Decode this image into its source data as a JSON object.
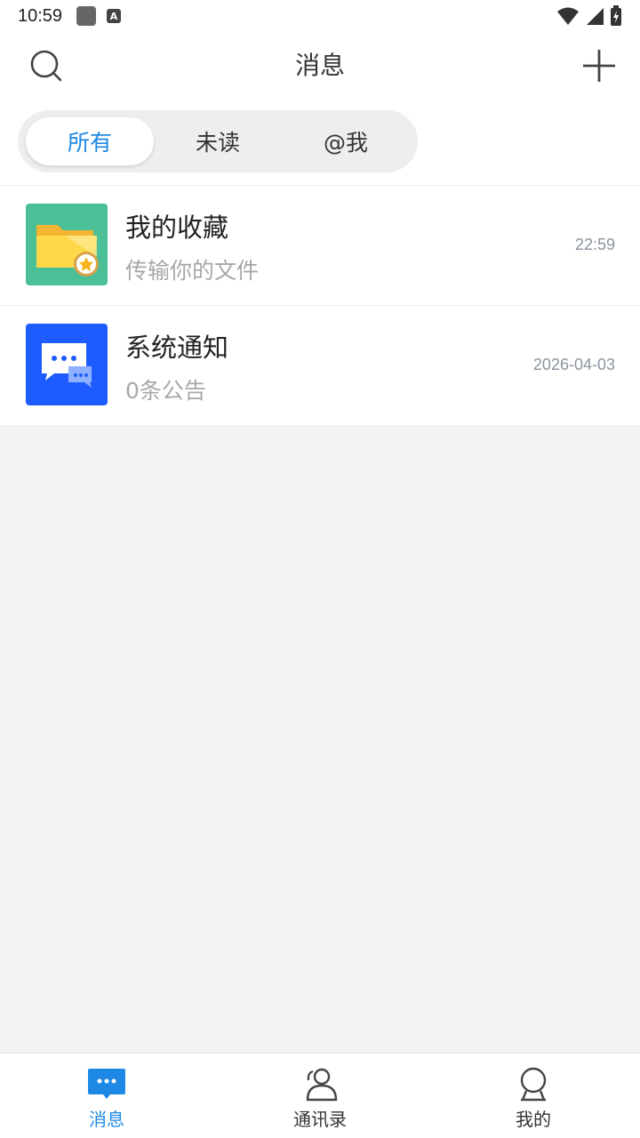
{
  "status_bar": {
    "time": "10:59",
    "badge_letter": "A"
  },
  "header": {
    "title": "消息"
  },
  "tabs": [
    {
      "label": "所有",
      "active": true
    },
    {
      "label": "未读",
      "active": false
    },
    {
      "label": "@我",
      "active": false
    }
  ],
  "conversations": [
    {
      "title": "我的收藏",
      "subtitle": "传输你的文件",
      "time": "22:59",
      "icon": "folder-star-icon"
    },
    {
      "title": "系统通知",
      "subtitle": "0条公告",
      "time": "2026-04-03",
      "icon": "chat-bubbles-icon"
    }
  ],
  "bottom_nav": [
    {
      "label": "消息",
      "icon": "message-icon",
      "active": true
    },
    {
      "label": "通讯录",
      "icon": "contacts-icon",
      "active": false
    },
    {
      "label": "我的",
      "icon": "profile-icon",
      "active": false
    }
  ],
  "colors": {
    "accent": "#1e88e5",
    "folder_bg": "#4bbf96",
    "notice_bg": "#1f5cff"
  }
}
